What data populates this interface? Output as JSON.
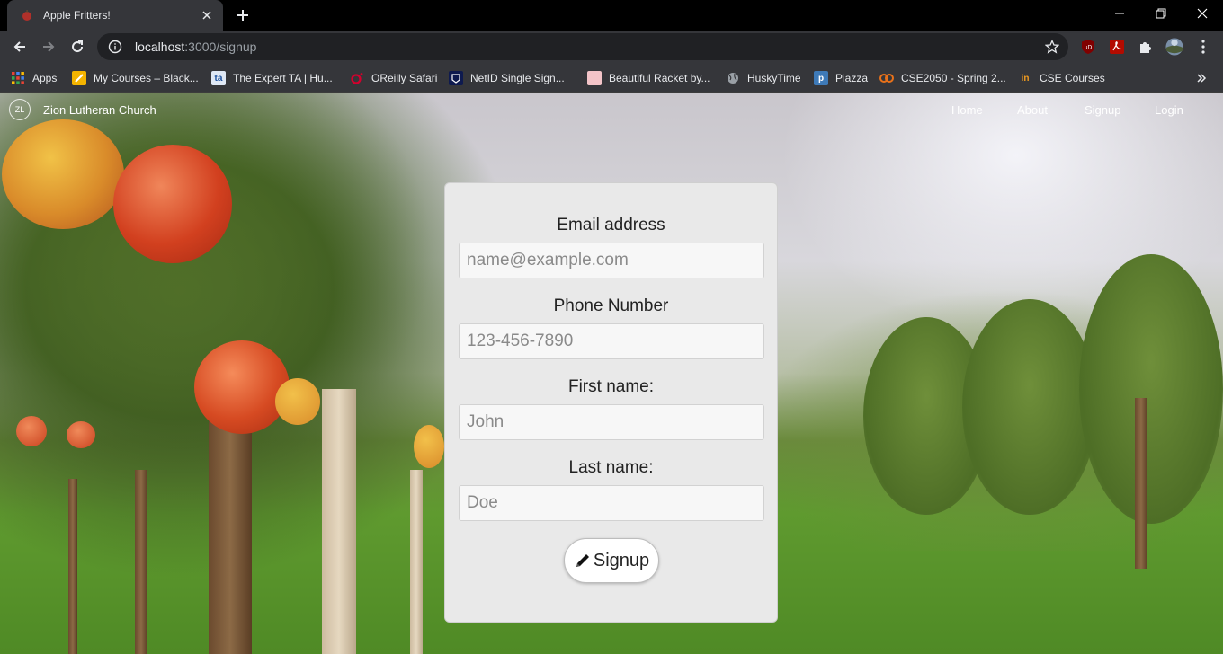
{
  "browser": {
    "tab": {
      "title": "Apple Fritters!"
    },
    "omnibox": {
      "host": "localhost",
      "path": ":3000/signup"
    },
    "bookmarks": [
      {
        "label": "Apps",
        "icon": "apps-grid-icon",
        "color": "#ea4335"
      },
      {
        "label": "My Courses – Black...",
        "icon": "blackboard-icon",
        "color": "#f4b400"
      },
      {
        "label": "The Expert TA | Hu...",
        "icon": "expert-ta-icon",
        "color": "#4285f4"
      },
      {
        "label": "OReilly Safari",
        "icon": "oreilly-icon",
        "color": "#d3002d"
      },
      {
        "label": "NetID Single Sign...",
        "icon": "netid-icon",
        "color": "#0e1a4f"
      },
      {
        "label": "Beautiful Racket by...",
        "icon": "racket-icon",
        "color": "#f3c4c8"
      },
      {
        "label": "HuskyTime",
        "icon": "globe-icon",
        "color": "#9aa0a6"
      },
      {
        "label": "Piazza",
        "icon": "piazza-icon",
        "color": "#3e7ab8"
      },
      {
        "label": "CSE2050 - Spring 2...",
        "icon": "cse2050-icon",
        "color": "#e8711a"
      },
      {
        "label": "CSE Courses",
        "icon": "cse-courses-icon",
        "color": "#f29c1f"
      }
    ]
  },
  "site": {
    "brand": "Zion Lutheran Church",
    "brand_logo_text": "ZL",
    "nav": [
      "Home",
      "About",
      "Signup",
      "Login"
    ]
  },
  "form": {
    "email_label": "Email address",
    "email_placeholder": "name@example.com",
    "phone_label": "Phone Number",
    "phone_placeholder": "123-456-7890",
    "first_label": "First name:",
    "first_placeholder": "John",
    "last_label": "Last name:",
    "last_placeholder": "Doe",
    "submit_label": "Signup",
    "submit_icon": "pencil-icon"
  }
}
